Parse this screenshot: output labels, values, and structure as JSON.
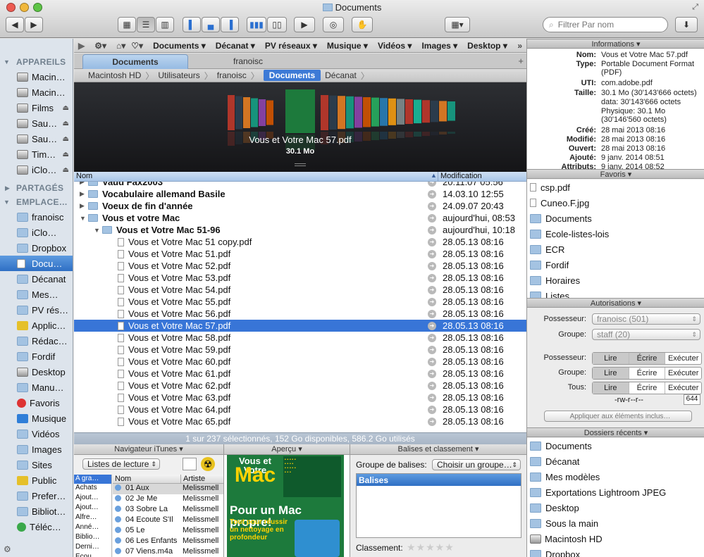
{
  "window": {
    "title": "Documents"
  },
  "toolbar": {
    "search_placeholder": "Filtrer Par nom",
    "view_buttons": [
      "icon-view-icon",
      "list-view-icon",
      "column-view-icon"
    ]
  },
  "sidebar": {
    "devices_header": "APPAREILS",
    "devices": [
      {
        "label": "Macin…",
        "icon": "imac-icon"
      },
      {
        "label": "Macin…",
        "icon": "hard-drive-icon"
      },
      {
        "label": "Films",
        "icon": "drive-icon",
        "eject": true
      },
      {
        "label": "Sau…",
        "icon": "drive-icon",
        "eject": true
      },
      {
        "label": "Sau…",
        "icon": "drive-icon",
        "eject": true
      },
      {
        "label": "Tim…",
        "icon": "time-machine-icon",
        "eject": true
      },
      {
        "label": "iClo…",
        "icon": "drive-icon",
        "eject": true
      }
    ],
    "shared_header": "PARTAGÉS",
    "places_header": "EMPLACE…",
    "places": [
      {
        "label": "franoisc",
        "icon": "home-icon"
      },
      {
        "label": "iClo…",
        "icon": "cloud-folder-icon"
      },
      {
        "label": "Dropbox",
        "icon": "folder-icon"
      },
      {
        "label": "Docu…",
        "icon": "document-icon",
        "selected": true
      },
      {
        "label": "Décanat",
        "icon": "folder-icon"
      },
      {
        "label": "Mes…",
        "icon": "folder-icon"
      },
      {
        "label": "PV rés…",
        "icon": "folder-icon"
      },
      {
        "label": "Applic…",
        "icon": "applications-icon"
      },
      {
        "label": "Rédac…",
        "icon": "folder-icon"
      },
      {
        "label": "Fordif",
        "icon": "folder-icon"
      },
      {
        "label": "Desktop",
        "icon": "desktop-icon"
      },
      {
        "label": "Manu…",
        "icon": "folder-icon"
      },
      {
        "label": "Favoris",
        "icon": "heart-icon"
      },
      {
        "label": "Musique",
        "icon": "music-icon"
      },
      {
        "label": "Vidéos",
        "icon": "folder-icon"
      },
      {
        "label": "Images",
        "icon": "folder-icon"
      },
      {
        "label": "Sites",
        "icon": "folder-icon"
      },
      {
        "label": "Public",
        "icon": "public-icon"
      },
      {
        "label": "Prefer…",
        "icon": "folder-icon"
      },
      {
        "label": "Bibliot…",
        "icon": "folder-icon"
      },
      {
        "label": "Téléc…",
        "icon": "downloads-icon"
      }
    ]
  },
  "favbar": {
    "items": [
      "Documents ▾",
      "Décanat ▾",
      "PV réseaux ▾",
      "Musique ▾",
      "Vidéos ▾",
      "Images ▾",
      "Desktop ▾"
    ]
  },
  "tabs": [
    "Documents",
    "franoisc"
  ],
  "breadcrumb": [
    "Macintosh HD",
    "Utilisateurs",
    "franoisc",
    "Documents",
    "Décanat"
  ],
  "coverflow": {
    "filename": "Vous et Votre Mac 57.pdf",
    "size": "30.1 Mo"
  },
  "list": {
    "col_name": "Nom",
    "col_date": "Modification",
    "rows": [
      {
        "name": "Vaud Fax2003",
        "date": "20.11.07 05:56",
        "level": 0,
        "kind": "folder",
        "bold": true
      },
      {
        "name": "Vocabulaire allemand Basile",
        "date": "14.03.10 12:55",
        "level": 0,
        "kind": "folder",
        "bold": true
      },
      {
        "name": "Voeux de fin d'année",
        "date": "24.09.07 20:43",
        "level": 0,
        "kind": "folder",
        "bold": true
      },
      {
        "name": "Vous et votre Mac",
        "date": "aujourd'hui, 08:53",
        "level": 0,
        "kind": "folder",
        "bold": true,
        "open": true
      },
      {
        "name": "Vous et Votre Mac 51-96",
        "date": "aujourd'hui, 10:18",
        "level": 1,
        "kind": "folder",
        "bold": true,
        "open": true
      },
      {
        "name": "Vous et Votre Mac 51 copy.pdf",
        "date": "28.05.13 08:16",
        "level": 2,
        "kind": "pdf"
      },
      {
        "name": "Vous et Votre Mac 51.pdf",
        "date": "28.05.13 08:16",
        "level": 2,
        "kind": "pdf"
      },
      {
        "name": "Vous et Votre Mac 52.pdf",
        "date": "28.05.13 08:16",
        "level": 2,
        "kind": "pdf"
      },
      {
        "name": "Vous et Votre Mac 53.pdf",
        "date": "28.05.13 08:16",
        "level": 2,
        "kind": "pdf"
      },
      {
        "name": "Vous et Votre Mac 54.pdf",
        "date": "28.05.13 08:16",
        "level": 2,
        "kind": "pdf"
      },
      {
        "name": "Vous et Votre Mac 55.pdf",
        "date": "28.05.13 08:16",
        "level": 2,
        "kind": "pdf"
      },
      {
        "name": "Vous et Votre Mac 56.pdf",
        "date": "28.05.13 08:16",
        "level": 2,
        "kind": "pdf"
      },
      {
        "name": "Vous et Votre Mac 57.pdf",
        "date": "28.05.13 08:16",
        "level": 2,
        "kind": "pdf",
        "selected": true
      },
      {
        "name": "Vous et Votre Mac 58.pdf",
        "date": "28.05.13 08:16",
        "level": 2,
        "kind": "pdf"
      },
      {
        "name": "Vous et Votre Mac 59.pdf",
        "date": "28.05.13 08:16",
        "level": 2,
        "kind": "pdf"
      },
      {
        "name": "Vous et Votre Mac 60.pdf",
        "date": "28.05.13 08:16",
        "level": 2,
        "kind": "pdf"
      },
      {
        "name": "Vous et Votre Mac 61.pdf",
        "date": "28.05.13 08:16",
        "level": 2,
        "kind": "pdf"
      },
      {
        "name": "Vous et Votre Mac 62.pdf",
        "date": "28.05.13 08:16",
        "level": 2,
        "kind": "pdf"
      },
      {
        "name": "Vous et Votre Mac 63.pdf",
        "date": "28.05.13 08:16",
        "level": 2,
        "kind": "pdf"
      },
      {
        "name": "Vous et Votre Mac 64.pdf",
        "date": "28.05.13 08:16",
        "level": 2,
        "kind": "pdf"
      },
      {
        "name": "Vous et Votre Mac 65.pdf",
        "date": "28.05.13 08:16",
        "level": 2,
        "kind": "pdf"
      }
    ]
  },
  "status": "1 sur 237 sélectionnés, 152 Go disponibles, 586.2 Go utilisés",
  "itunes": {
    "header": "Navigateur iTunes ▾",
    "popup": "Listes de lecture",
    "col_artist_group": "A gra…",
    "col_name": "Nom",
    "col_artist": "Artiste",
    "groups": [
      "Achats",
      "Ajout…",
      "Ajout…",
      "Alfre…",
      "Anné…",
      "Biblio…",
      "Derni…",
      "Écou…"
    ],
    "tracks": [
      {
        "name": "01 Aux",
        "artist": "Melissmell"
      },
      {
        "name": "02 Je Me",
        "artist": "Melissmell"
      },
      {
        "name": "03 Sobre La",
        "artist": "Melissmell"
      },
      {
        "name": "04 Ecoute S'Il",
        "artist": "Melissmell"
      },
      {
        "name": "05 Le",
        "artist": "Melissmell"
      },
      {
        "name": "06 Les Enfants",
        "artist": "Melissmell"
      },
      {
        "name": "07 Viens.m4a",
        "artist": "Melissmell"
      }
    ]
  },
  "apercu": {
    "header": "Aperçu ▾",
    "mag_title": "Vous et Votre Mac",
    "mag_headline": "Pour un Mac propre!",
    "mag_sub": "Tout pour réussir un nettoyage en profondeur"
  },
  "balises": {
    "header": "Balises et classement ▾",
    "group_label": "Groupe de balises:",
    "group_popup": "Choisir un groupe…",
    "list_header": "Balises",
    "rating_label": "Classement:",
    "stars": "★★★★★"
  },
  "inspector": {
    "info_header": "Informations ▾",
    "info": [
      {
        "label": "Nom:",
        "value": "Vous et Votre Mac 57.pdf"
      },
      {
        "label": "Type:",
        "value": "Portable Document Format (PDF)"
      },
      {
        "label": "UTI:",
        "value": "com.adobe.pdf"
      },
      {
        "label": "Taille:",
        "value": "30.1 Mo (30'143'666 octets)"
      },
      {
        "label": "",
        "value": "data: 30'143'666 octets"
      },
      {
        "label": "",
        "value": "Physique: 30.1 Mo (30'146'560 octets)"
      },
      {
        "label": "Créé:",
        "value": "28 mai 2013 08:16"
      },
      {
        "label": "Modifié:",
        "value": "28 mai 2013 08:16"
      },
      {
        "label": "Ouvert:",
        "value": "28 mai 2013 08:16"
      },
      {
        "label": "Ajouté:",
        "value": "9 janv. 2014 08:51"
      },
      {
        "label": "Attributs:",
        "value": "9 janv. 2014 08:52"
      }
    ],
    "favoris_header": "Favoris ▾",
    "favoris": [
      {
        "label": "csp.pdf",
        "icon": "pdf-icon"
      },
      {
        "label": "Cuneo.F.jpg",
        "icon": "image-file-icon"
      },
      {
        "label": "Documents",
        "icon": "folder-icon"
      },
      {
        "label": "Ecole-listes-lois",
        "icon": "folder-icon"
      },
      {
        "label": "ECR",
        "icon": "folder-icon"
      },
      {
        "label": "Fordif",
        "icon": "folder-icon"
      },
      {
        "label": "Horaires",
        "icon": "folder-icon"
      },
      {
        "label": "Listes",
        "icon": "folder-icon"
      }
    ],
    "auth_header": "Autorisations ▾",
    "owner_label": "Possesseur:",
    "owner_value": "franoisc (501)",
    "group_label": "Groupe:",
    "group_value": "staff (20)",
    "perm_rows": [
      "Possesseur:",
      "Groupe:",
      "Tous:"
    ],
    "perm_buttons": [
      "Lire",
      "Écrire",
      "Exécuter"
    ],
    "perm_string": "-rw-r--r--",
    "perm_octal": "644",
    "apply_button": "Appliquer aux éléments inclus…",
    "recent_header": "Dossiers récents ▾",
    "recent": [
      {
        "label": "Documents",
        "icon": "folder-icon"
      },
      {
        "label": "Décanat",
        "icon": "folder-icon"
      },
      {
        "label": "Mes modèles",
        "icon": "folder-icon"
      },
      {
        "label": "Exportations Lightroom JPEG",
        "icon": "folder-icon"
      },
      {
        "label": "Desktop",
        "icon": "folder-icon"
      },
      {
        "label": "Sous la main",
        "icon": "folder-icon"
      },
      {
        "label": "Macintosh HD",
        "icon": "hard-drive-icon"
      },
      {
        "label": "Dropbox",
        "icon": "folder-icon"
      }
    ]
  },
  "colors": {
    "accent": "#3875d7",
    "sidebar_bg": "#dde4ec",
    "coverflow_bg": "#1f2024"
  }
}
